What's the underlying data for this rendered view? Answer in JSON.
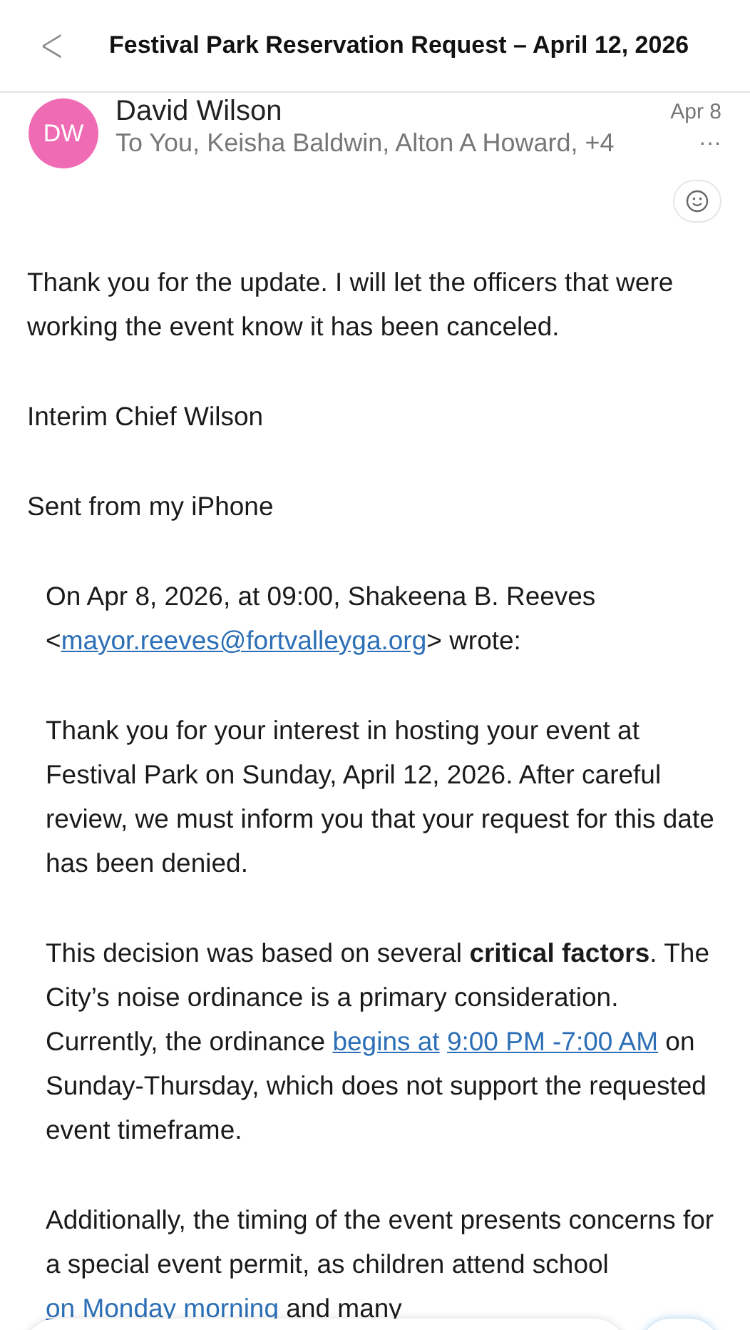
{
  "header": {
    "back": "<",
    "title": "Festival Park Reservation Request – April 12, 2026"
  },
  "message": {
    "initials": "DW",
    "sender": "David Wilson",
    "date": "Apr 8",
    "recipients": "To You, Keisha Baldwin, Alton A Howard, +4",
    "more": "···"
  },
  "body": [
    {
      "quoted": false,
      "segments": [
        {
          "kind": "text",
          "text": "Thank you for the update. I will let the officers that were working the event know it has been canceled."
        }
      ]
    },
    {
      "quoted": false,
      "segments": [
        {
          "kind": "text",
          "text": "Interim Chief Wilson"
        }
      ]
    },
    {
      "quoted": false,
      "segments": [
        {
          "kind": "text",
          "text": "Sent from my iPhone"
        }
      ]
    },
    {
      "quoted": true,
      "segments": [
        {
          "kind": "text",
          "text": "On Apr 8, 2026, at 09:00, Shakeena B. Reeves <"
        },
        {
          "kind": "link",
          "text": "mayor.reeves@fortvalleyga.org"
        },
        {
          "kind": "text",
          "text": "> wrote:"
        }
      ]
    },
    {
      "quoted": true,
      "segments": [
        {
          "kind": "text",
          "text": "Thank you for your interest in hosting your event at Festival Park on Sunday, April 12, 2026. After careful review, we must inform you that your request for this date has been denied."
        }
      ]
    },
    {
      "quoted": true,
      "segments": [
        {
          "kind": "text",
          "text": "This decision was based on several **critical factors**. The City’s noise ordinance is a primary consideration. Currently, the ordinance "
        },
        {
          "kind": "link",
          "text": "begins at"
        },
        {
          "kind": "link",
          "text": "9:00 PM -7:00 AM"
        },
        {
          "kind": "text",
          "text": " on Sunday-Thursday, which does not support the requested event timeframe."
        }
      ]
    },
    {
      "quoted": true,
      "segments": [
        {
          "kind": "text",
          "text": "Additionally, the timing of the event presents concerns for a special event permit, as children attend school "
        },
        {
          "kind": "link",
          "text": "on Monday morning"
        },
        {
          "kind": "text",
          "text": " and many"
        }
      ]
    }
  ]
}
